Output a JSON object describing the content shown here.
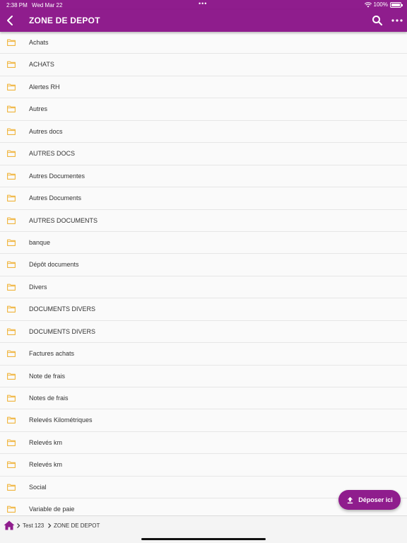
{
  "status_bar": {
    "time": "2:38 PM",
    "date": "Wed Mar 22",
    "dots": "•••",
    "battery": "100%"
  },
  "app_bar": {
    "title": "ZONE DE DEPOT"
  },
  "folders": [
    "Achats",
    "ACHATS",
    "Alertes RH",
    "Autres",
    "Autres docs",
    "AUTRES DOCS",
    "Autres Documentes",
    "Autres Documents",
    "AUTRES DOCUMENTS",
    "banque",
    "Dépôt documents",
    "Divers",
    "DOCUMENTS DIVERS",
    "DOCUMENTS DIVERS",
    "Factures achats",
    "Note de frais",
    "Notes de frais",
    "Relevés Kilométriques",
    "Relevés km",
    "Relevés km",
    "Social",
    "Variable de paie"
  ],
  "fab": {
    "label": "Déposer ici"
  },
  "breadcrumb": {
    "items": [
      "Test 123",
      "ZONE DE DEPOT"
    ]
  },
  "colors": {
    "brand": "#8f1d8d",
    "folder": "#f0b43c"
  },
  "icons": {
    "back": "chevron-left-icon",
    "search": "search-icon",
    "more": "more-horizontal-icon",
    "folder": "folder-icon",
    "home": "home-icon",
    "upload": "upload-icon"
  }
}
